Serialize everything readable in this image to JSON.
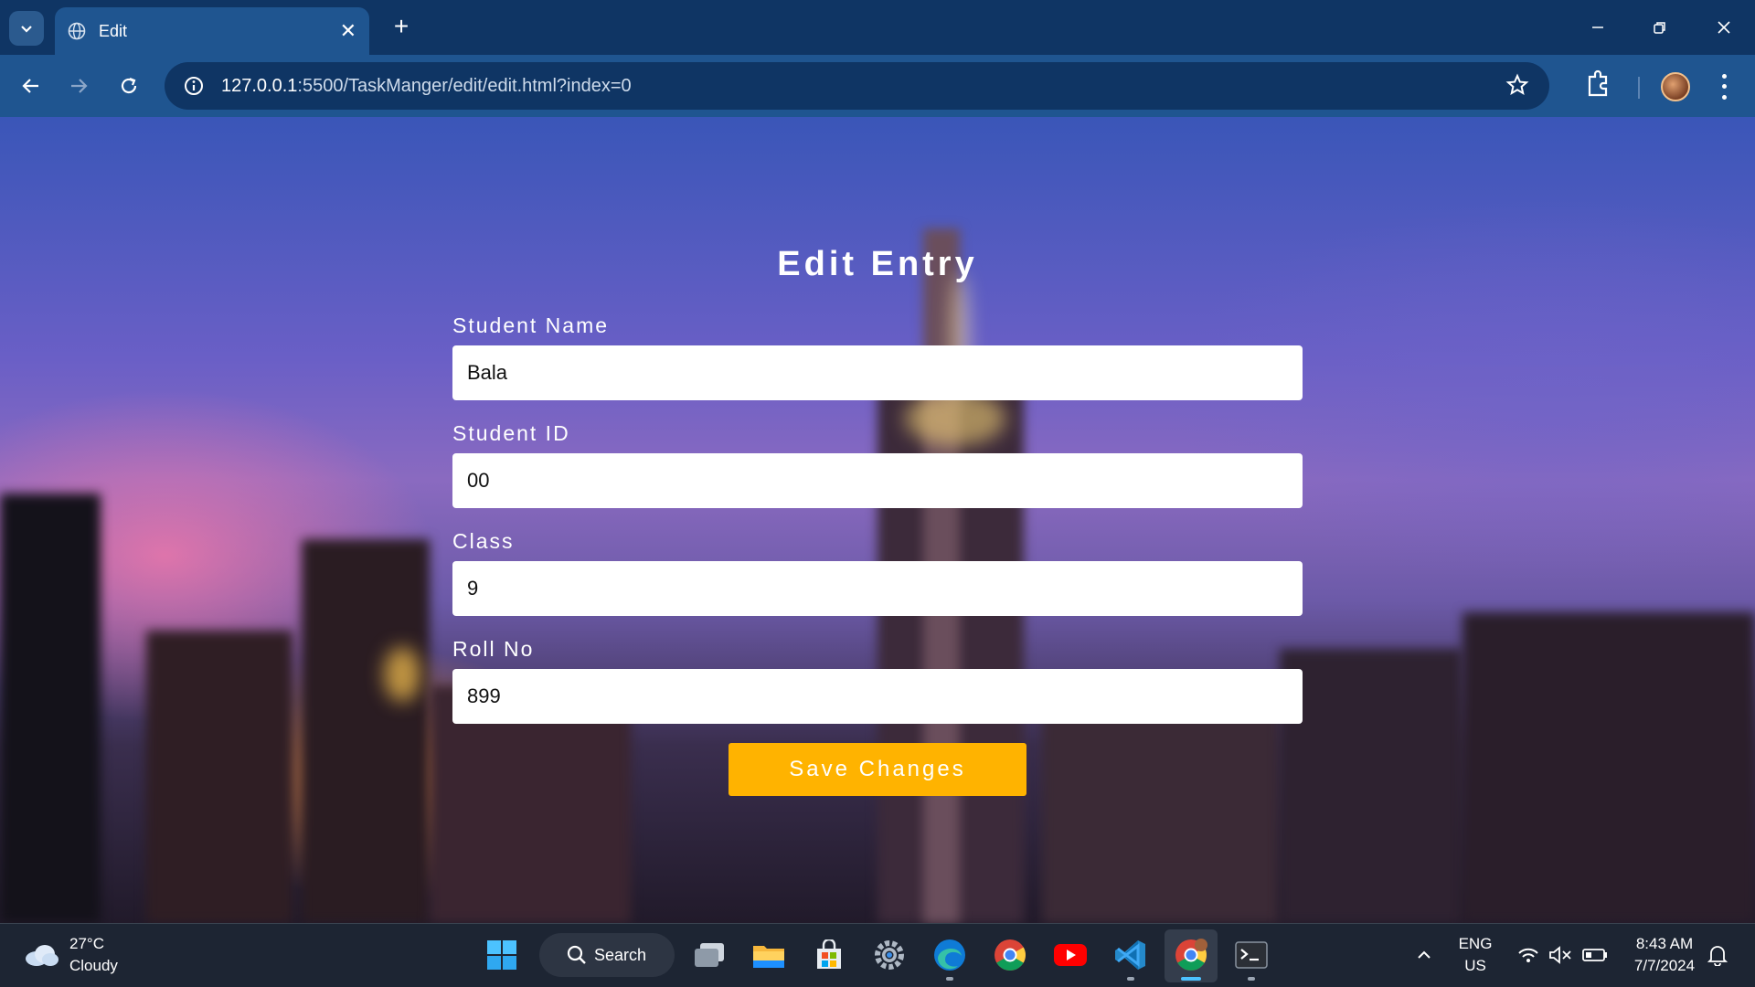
{
  "browser": {
    "tab_title": "Edit",
    "url_host": "127.0.0.1",
    "url_rest": ":5500/TaskManger/edit/edit.html?index=0"
  },
  "form": {
    "title": "Edit Entry",
    "fields": [
      {
        "label": "Student Name",
        "value": "Bala"
      },
      {
        "label": "Student ID",
        "value": "00"
      },
      {
        "label": "Class",
        "value": "9"
      },
      {
        "label": "Roll No",
        "value": "899"
      }
    ],
    "save_label": "Save Changes"
  },
  "taskbar": {
    "weather_temp": "27°C",
    "weather_desc": "Cloudy",
    "search_label": "Search",
    "lang_line1": "ENG",
    "lang_line2": "US",
    "time": "8:43 AM",
    "date": "7/7/2024"
  },
  "colors": {
    "titlebar": "#0f3564",
    "toolbar": "#1f5590",
    "save_button": "#ffb300",
    "taskbar": "#1d2533"
  }
}
